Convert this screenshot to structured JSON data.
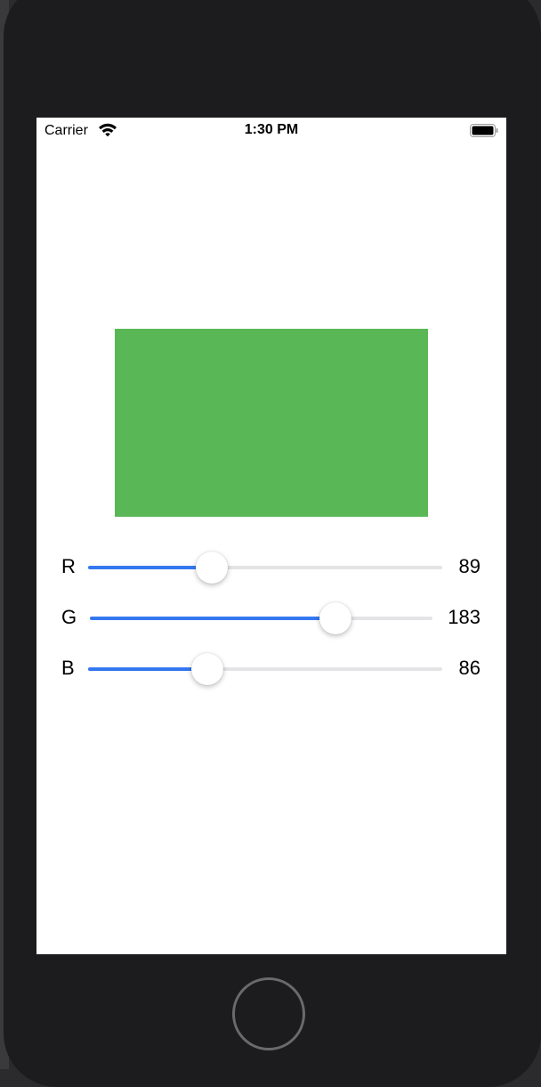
{
  "status_bar": {
    "carrier": "Carrier",
    "time": "1:30 PM",
    "wifi_icon": "wifi-icon",
    "battery_icon": "battery-icon",
    "battery_level": 1.0
  },
  "preview": {
    "color": "#59b756"
  },
  "sliders": [
    {
      "label": "R",
      "value": "89",
      "max": 255,
      "fraction": 0.349
    },
    {
      "label": "G",
      "value": "183",
      "max": 255,
      "fraction": 0.718
    },
    {
      "label": "B",
      "value": "86",
      "max": 255,
      "fraction": 0.337
    }
  ],
  "colors": {
    "accent": "#3478f0",
    "track": "#e4e4e6"
  },
  "home_button_icon": "home-button-icon"
}
